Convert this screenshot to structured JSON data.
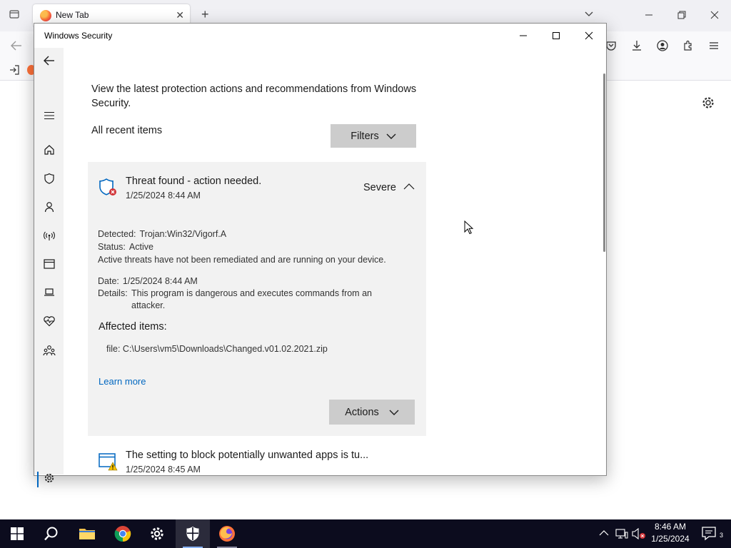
{
  "browser": {
    "tab_title": "New Tab",
    "tab_close": "✕",
    "new_tab": "+"
  },
  "security_window": {
    "title": "Windows Security",
    "intro": "View the latest protection actions and recommendations from Windows Security.",
    "all_recent_items": "All recent items",
    "filters_label": "Filters",
    "threat": {
      "title": "Threat found - action needed.",
      "date": "1/25/2024 8:44 AM",
      "severity": "Severe",
      "detected_label": "Detected:",
      "detected_value": "Trojan:Win32/Vigorf.A",
      "status_label": "Status:",
      "status_value": "Active",
      "active_note": "Active threats have not been remediated and are running on your device.",
      "date_label": "Date:",
      "date_value": "1/25/2024 8:44 AM",
      "details_label": "Details:",
      "details_value": "This program is dangerous and executes commands from an attacker.",
      "affected_heading": "Affected items:",
      "affected_file": "file: C:\\Users\\vm5\\Downloads\\Changed.v01.02.2021.zip",
      "learn_more": "Learn more",
      "actions_label": "Actions"
    },
    "second_item": {
      "title": "The setting to block potentially unwanted apps is tu...",
      "date": "1/25/2024 8:45 AM"
    }
  },
  "taskbar": {
    "time": "8:46 AM",
    "date": "1/25/2024",
    "notification_count": "3"
  },
  "colors": {
    "accent": "#0067c0",
    "severe_red": "#d13438",
    "taskbar": "#0c0c1e"
  }
}
